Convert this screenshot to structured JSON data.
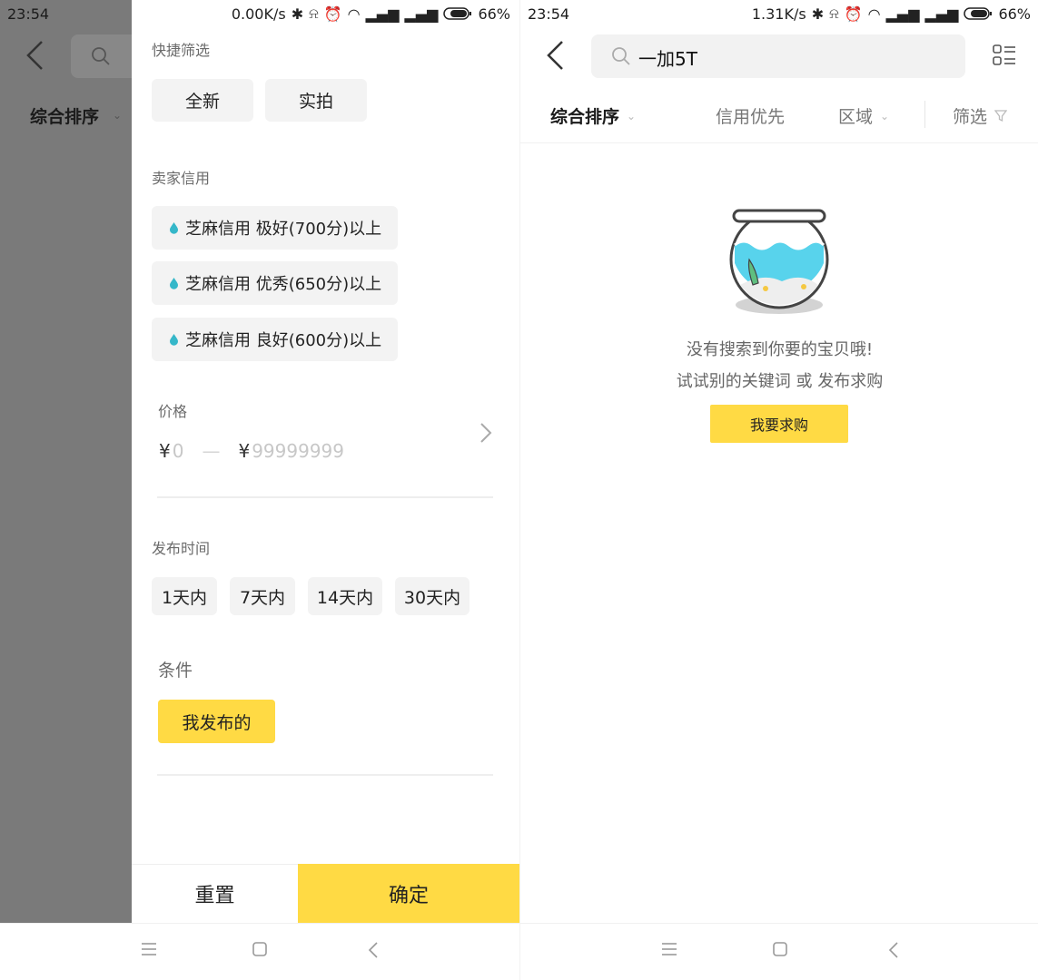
{
  "left_screen": {
    "status_time": "23:54",
    "status_right": {
      "net_speed": "0.00K/s",
      "battery": "66%"
    },
    "sort_label": "综合排序",
    "drawer": {
      "quick_filter": {
        "title": "快捷筛选",
        "chips": [
          "全新",
          "实拍"
        ]
      },
      "seller_credit": {
        "title": "卖家信用",
        "options": [
          "芝麻信用 极好(700分)以上",
          "芝麻信用 优秀(650分)以上",
          "芝麻信用 良好(600分)以上"
        ]
      },
      "price": {
        "title": "价格",
        "currency": "¥",
        "min_placeholder": "0",
        "separator": "—",
        "max_placeholder": "99999999"
      },
      "publish_time": {
        "title": "发布时间",
        "options": [
          "1天内",
          "7天内",
          "14天内",
          "30天内"
        ]
      },
      "condition": {
        "title": "条件",
        "option": "我发布的"
      },
      "reset_label": "重置",
      "confirm_label": "确定"
    }
  },
  "right_screen": {
    "status_time": "23:54",
    "status_right": {
      "net_speed": "1.31K/s",
      "battery": "66%"
    },
    "search_query": "一加5T",
    "tabs": {
      "comprehensive": "综合排序",
      "credit_first": "信用优先",
      "region": "区域",
      "filter": "筛选"
    },
    "empty_state": {
      "line1": "没有搜索到你要的宝贝哦!",
      "line2": "试试别的关键词 或 发布求购",
      "button": "我要求购"
    }
  },
  "colors": {
    "accent": "#ffda44",
    "overlay": "#7a7a7a",
    "chip_bg": "#f3f3f3",
    "credit_drop": "#35b7c9"
  },
  "icons": [
    "back-icon",
    "search-icon",
    "list-view-icon",
    "chevron-down-icon",
    "funnel-icon",
    "chevron-right-icon",
    "credit-drop-icon",
    "fishbowl-illustration",
    "menu-nav-icon",
    "home-nav-icon",
    "back-nav-icon"
  ]
}
